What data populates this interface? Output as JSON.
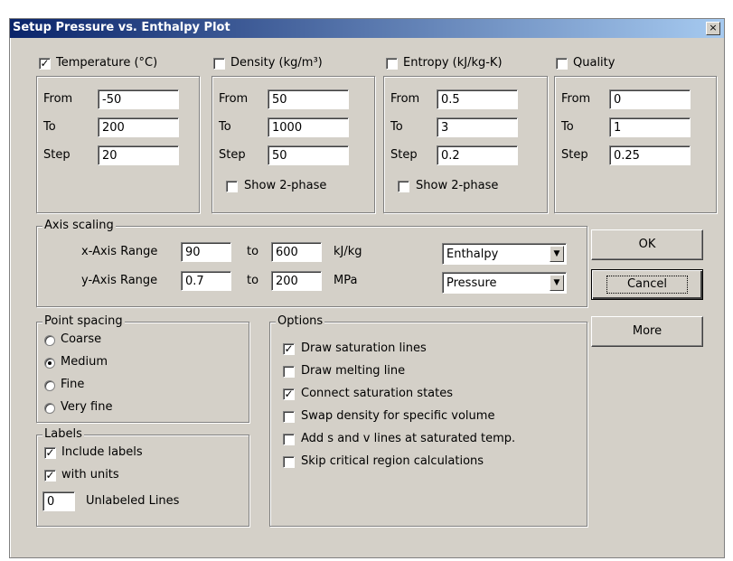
{
  "dialog": {
    "title": "Setup Pressure vs. Enthalpy Plot",
    "close_glyph": "×"
  },
  "panels": [
    {
      "label": "Temperature (°C)",
      "checked": true,
      "from": "-50",
      "to": "200",
      "step": "20"
    },
    {
      "label": "Density (kg/m³)",
      "checked": false,
      "from": "50",
      "to": "1000",
      "step": "50",
      "show2": "Show 2-phase",
      "show2_checked": false
    },
    {
      "label": "Entropy (kJ/kg-K)",
      "checked": false,
      "from": "0.5",
      "to": "3",
      "step": "0.2",
      "show2": "Show 2-phase",
      "show2_checked": false
    },
    {
      "label": "Quality",
      "checked": false,
      "from": "0",
      "to": "1",
      "step": "0.25"
    }
  ],
  "field_labels": {
    "from": "From",
    "to": "To",
    "step": "Step"
  },
  "axis": {
    "title": "Axis scaling",
    "x_label": "x-Axis Range",
    "x_from": "90",
    "x_to": "600",
    "x_unit": "kJ/kg",
    "x_select": "Enthalpy",
    "y_label": "y-Axis Range",
    "y_from": "0.7",
    "y_to": "200",
    "y_unit": "MPa",
    "y_select": "Pressure",
    "to_word": "to"
  },
  "buttons": {
    "ok": "OK",
    "cancel": "Cancel",
    "more": "More"
  },
  "point_spacing": {
    "title": "Point spacing",
    "options": [
      {
        "label": "Coarse",
        "checked": false
      },
      {
        "label": "Medium",
        "checked": true
      },
      {
        "label": "Fine",
        "checked": false
      },
      {
        "label": "Very fine",
        "checked": false
      }
    ]
  },
  "labels_group": {
    "title": "Labels",
    "include_labels": "Include labels",
    "include_checked": true,
    "with_units": "with units",
    "units_checked": true,
    "unlabeled_value": "0",
    "unlabeled_text": "Unlabeled Lines"
  },
  "options": {
    "title": "Options",
    "items": [
      {
        "label": "Draw saturation lines",
        "checked": true
      },
      {
        "label": "Draw melting line",
        "checked": false
      },
      {
        "label": "Connect saturation states",
        "checked": true
      },
      {
        "label": "Swap density for specific volume",
        "checked": false
      },
      {
        "label": "Add s and v lines at saturated temp.",
        "checked": false
      },
      {
        "label": "Skip critical region calculations",
        "checked": false
      }
    ]
  },
  "checkmark": "✓"
}
